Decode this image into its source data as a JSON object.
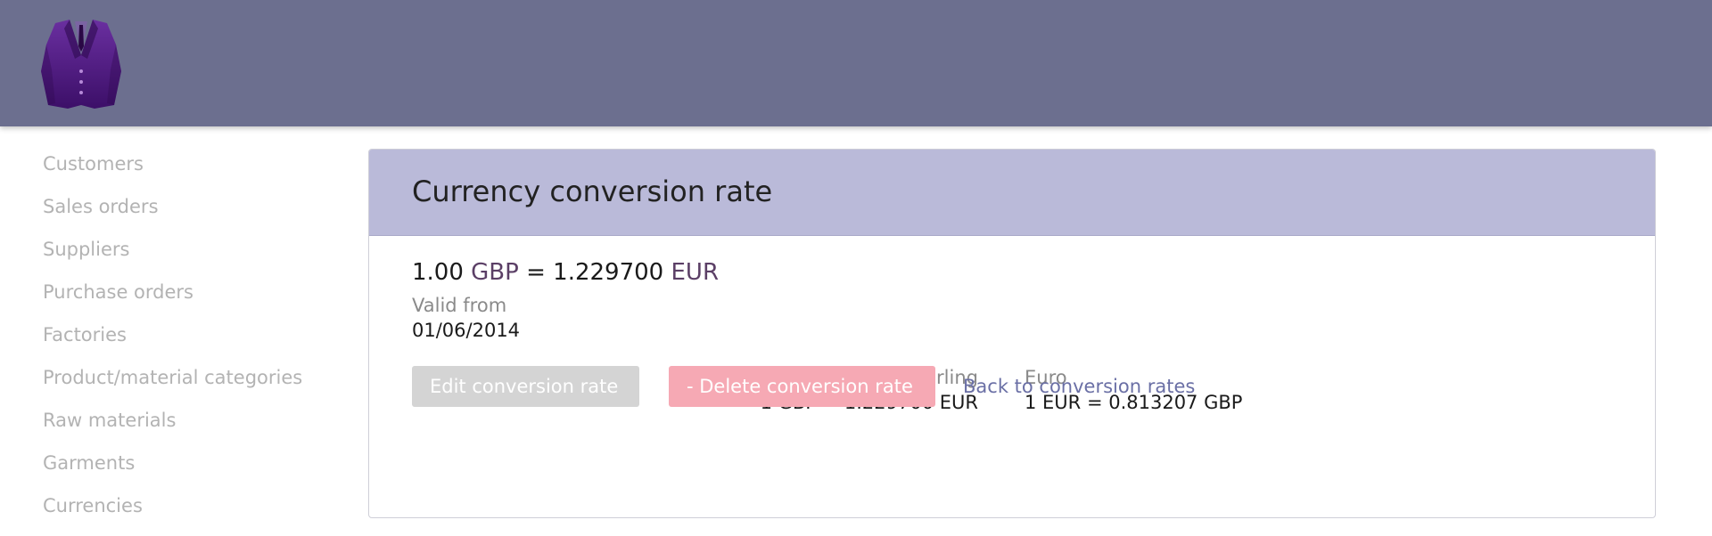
{
  "header": {
    "logo_icon": "suit-jacket-logo-icon",
    "background_color": "#6c6f8f",
    "logo_color": "#4a1a7a"
  },
  "sidebar": {
    "items": [
      {
        "label": "Customers"
      },
      {
        "label": "Sales orders"
      },
      {
        "label": "Suppliers"
      },
      {
        "label": "Purchase orders"
      },
      {
        "label": "Factories"
      },
      {
        "label": "Product/material categories"
      },
      {
        "label": "Raw materials"
      },
      {
        "label": "Garments"
      },
      {
        "label": "Currencies"
      }
    ]
  },
  "card": {
    "title": "Currency conversion rate",
    "header_color": "#babad9",
    "rate": {
      "from_amount": "1.00",
      "from_currency": "GBP",
      "equals": "=",
      "to_amount": "1.229700",
      "to_currency": "EUR"
    },
    "valid_from_label": "Valid from",
    "valid_from_value": "01/06/2014",
    "compare": {
      "left_name": "Pound Sterling",
      "left_rate": "1 GBP = 1.229700 EUR",
      "right_name": "Euro",
      "right_rate": "1 EUR = 0.813207 GBP"
    },
    "actions": {
      "edit_label": "Edit conversion rate",
      "delete_label": "- Delete conversion rate",
      "back_label": "Back to conversion rates",
      "edit_color": "#d4d4d4",
      "delete_color": "#f6a9b4",
      "link_color": "#6a6fa5"
    }
  }
}
